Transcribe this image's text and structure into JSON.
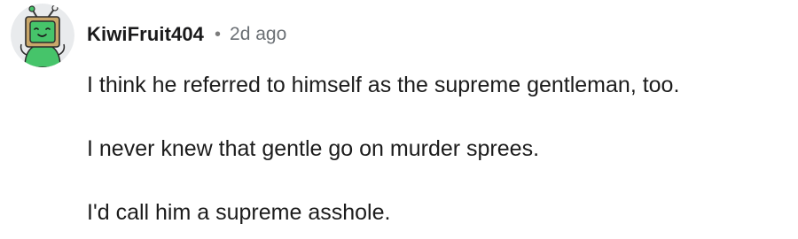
{
  "comment": {
    "author": "KiwiFruit404",
    "separator": "•",
    "timestamp": "2d ago",
    "avatar_icon": "kiwi-tv-mascot-icon",
    "paragraphs": [
      "I think he referred to himself as the supreme gentleman, too.",
      "I never knew that gentle go on murder sprees.",
      "I'd call him a supreme asshole."
    ]
  },
  "colors": {
    "avatar_background": "#e9ebed",
    "mascot_tan": "#c9a76a",
    "mascot_green": "#46c46a",
    "text": "#1c1c1c",
    "meta_text": "#6b7075"
  }
}
